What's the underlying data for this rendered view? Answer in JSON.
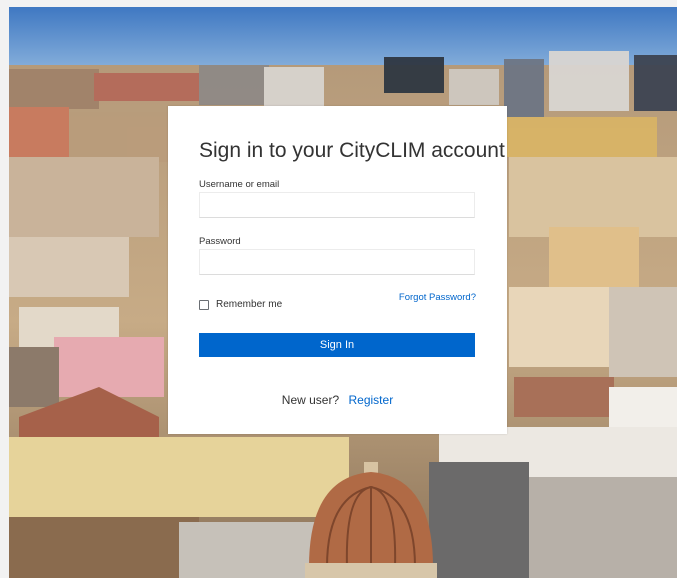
{
  "login": {
    "title": "Sign in to your CityCLIM account",
    "username_label": "Username or email",
    "username_value": "",
    "password_label": "Password",
    "password_value": "",
    "remember_label": "Remember me",
    "remember_checked": false,
    "forgot_label": "Forgot Password?",
    "signin_label": "Sign In",
    "new_user_text": "New user?",
    "register_label": "Register"
  },
  "colors": {
    "accent": "#0066cc",
    "sky": "#4f86c6",
    "card": "#ffffff"
  },
  "background": {
    "scene": "city-rooftops-photo"
  }
}
